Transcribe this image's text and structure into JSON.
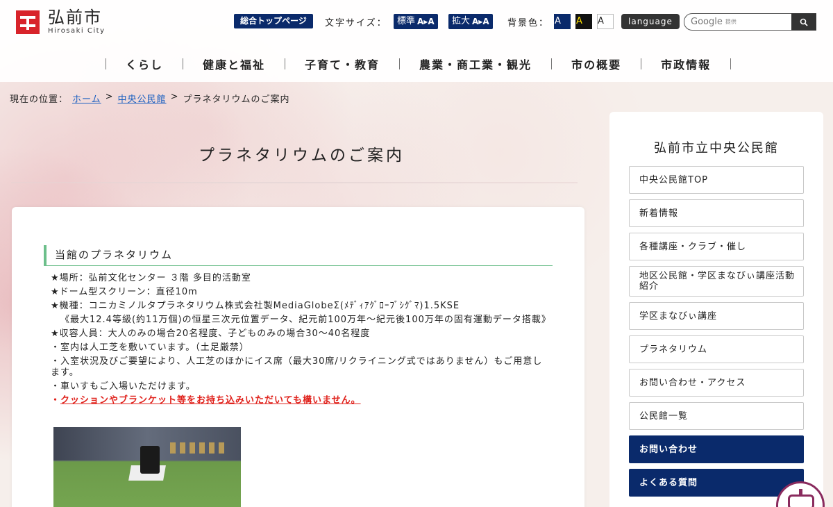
{
  "header": {
    "logo_jp": "弘前市",
    "logo_en": "Hirosaki City",
    "top_page_label": "総合トップページ",
    "font_size_label": "文字サイズ：",
    "font_standard": "標準",
    "font_large": "拡大",
    "font_aa": "A▸A",
    "bg_color_label": "背景色：",
    "bg_a": "A",
    "language_label": "language",
    "search_brand": "Google",
    "search_provided": "提供"
  },
  "nav": {
    "items": [
      "くらし",
      "健康と福祉",
      "子育て・教育",
      "農業・商工業・観光",
      "市の概要",
      "市政情報"
    ]
  },
  "breadcrumb": {
    "prefix": "現在の位置：",
    "home": "ホーム",
    "sep": ">",
    "parent": "中央公民館",
    "current": "プラネタリウムのご案内"
  },
  "main": {
    "title": "プラネタリウムのご案内",
    "section_heading": "当館のプラネタリウム",
    "lines": {
      "place": "★場所：弘前文化センター ３階 多目的活動室",
      "dome": "★ドーム型スクリーン：直径10m",
      "model": "★機種：コニカミノルタプラネタリウム株式会社製MediaGlobeΣ(ﾒﾃﾞｨｱｸﾞﾛｰﾌﾞｼｸﾞﾏ)1.5KSE",
      "model_detail": "《最大12.4等級(約11万個)の恒星三次元位置データ、紀元前100万年～紀元後100万年の固有運動データ搭載》",
      "capacity": "★収容人員：大人のみの場合20名程度、子どものみの場合30～40名程度",
      "turf": "・室内は人工芝を敷いています。（土足厳禁）",
      "chairs": "・入室状況及びご要望により、人工芝のほかにイス席（最大30席/リクライニング式ではありません）もご用意します。",
      "wheelchair": "・車いすもご入場いただけます。",
      "red_bullet": "・",
      "cushion": "クッションやブランケット等をお持ち込みいただいても構いません。"
    }
  },
  "sidebar": {
    "title": "弘前市立中央公民館",
    "items": [
      "中央公民館TOP",
      "新着情報",
      "各種講座・クラブ・催し",
      "地区公民館・学区まなびぃ講座活動紹介",
      "学区まなびぃ講座",
      "プラネタリウム",
      "お問い合わせ・アクセス",
      "公民館一覧"
    ],
    "dark_items": [
      "お問い合わせ",
      "よくある質問"
    ]
  },
  "colors": {
    "navy": "#0a2a6b",
    "red": "#d8232a",
    "green": "#6cbf8b",
    "alert_red": "#e0221c"
  }
}
